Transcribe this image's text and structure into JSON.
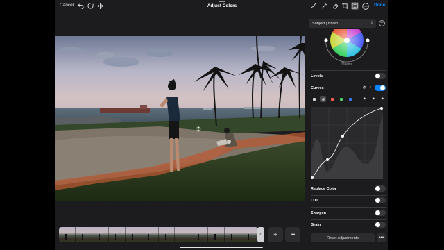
{
  "topbar": {
    "cancel": "Cancel",
    "title": "Adjust Colors",
    "done": "Done",
    "left_icons": [
      "undo-icon",
      "redo-icon",
      "compare-icon"
    ],
    "right_icons": [
      "brush-icon",
      "magic-wand-icon",
      "eraser-icon",
      "crop-icon",
      "adjust-icon",
      "more-icon"
    ]
  },
  "photo": {
    "description_icons": [
      "person-marker-icon",
      "brush-marker-icon"
    ]
  },
  "panel": {
    "subject_selector": "Subject | Brush",
    "wheel_label": "Master",
    "levels_label": "Levels",
    "levels_on": false,
    "curves_label": "Curves",
    "curves_on": true,
    "channels": [
      "luminance",
      "rgb",
      "red",
      "green",
      "blue"
    ],
    "channel_colors": {
      "luminance": "#d9d9d9",
      "rgb": "#b0b0b0",
      "red": "#ff5a4e",
      "green": "#4cd964",
      "blue": "#3b7cff"
    },
    "replace_color_label": "Replace Color",
    "replace_color_on": false,
    "lut_label": "LUT",
    "lut_on": false,
    "sharpen_label": "Sharpen",
    "sharpen_on": false,
    "grain_label": "Grain",
    "grain_on": false,
    "reset_label": "Reset Adjustments"
  },
  "filmstrip": {
    "handle_glyph": "c",
    "add_glyph": "+",
    "more_glyph": "•••"
  },
  "colors": {
    "accent": "#0a84ff",
    "background": "#1c1c1e",
    "control": "#2c2c2e"
  }
}
